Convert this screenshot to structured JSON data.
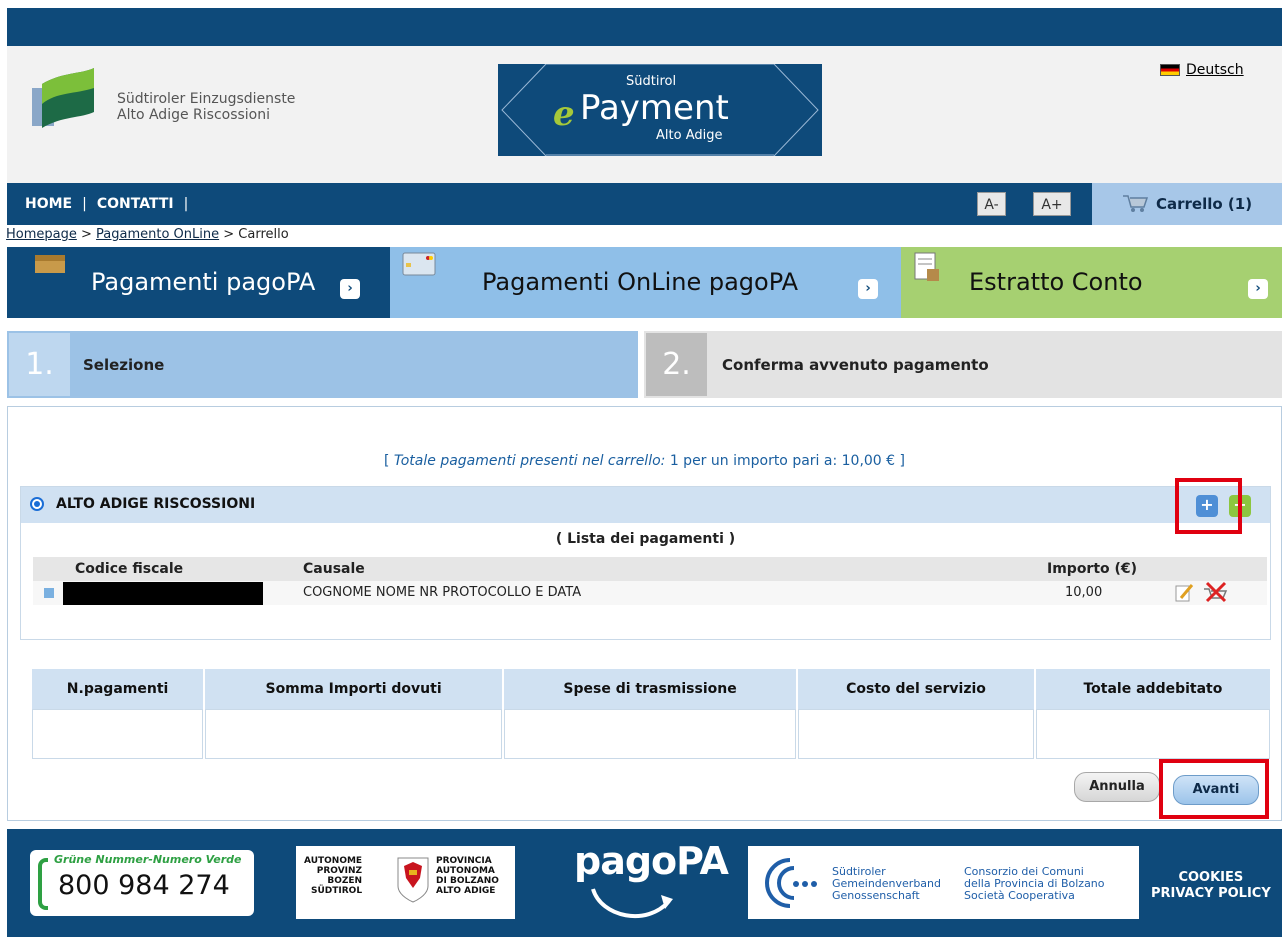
{
  "header": {
    "logo_line1": "Südtiroler Einzugsdienste",
    "logo_line2": "Alto Adige Riscossioni",
    "epayment_top": "Südtirol",
    "epayment_e": "e",
    "epayment_main": "Payment",
    "epayment_bottom": "Alto Adige",
    "language_link": "Deutsch"
  },
  "nav": {
    "home": "HOME",
    "sep1": "|",
    "contatti": "CONTATTI",
    "sep2": "|",
    "font_minus": "A-",
    "font_plus": "A+",
    "cart": "Carrello (1)"
  },
  "breadcrumb": {
    "homepage": "Homepage",
    "sep1": " > ",
    "pagamento": "Pagamento OnLine",
    "sep2": " > ",
    "current": "Carrello"
  },
  "tabs": [
    {
      "label": "Pagamenti pagoPA",
      "color": "#0e4a7a",
      "text_color": "#ffffff"
    },
    {
      "label": "Pagamenti OnLine pagoPA",
      "color": "#8fbfe8",
      "text_color": "#111111"
    },
    {
      "label": "Estratto Conto",
      "color": "#a6d071",
      "text_color": "#111111"
    }
  ],
  "steps": [
    {
      "num": "1.",
      "label": "Selezione",
      "color": "#9cc2e6"
    },
    {
      "num": "2.",
      "label": "Conferma avvenuto pagamento",
      "color": "#e3e3e3"
    }
  ],
  "cart_summary": {
    "prefix": "[ ",
    "italic": "Totale pagamenti presenti nel carrello:",
    "rest": " 1 per un importo pari a: 10,00 € ]"
  },
  "section": {
    "title": "ALTO ADIGE RISCOSSIONI",
    "add_blue": "+",
    "add_green": "+",
    "list_title": "( Lista dei pagamenti )",
    "columns": {
      "codice": "Codice fiscale",
      "causale": "Causale",
      "importo": "Importo (€)"
    },
    "rows": [
      {
        "causale": "COGNOME NOME NR PROTOCOLLO E DATA",
        "importo": "10,00"
      }
    ]
  },
  "totals": {
    "headers": [
      "N.pagamenti",
      "Somma Importi dovuti",
      "Spese di trasmissione",
      "Costo del servizio",
      "Totale addebitato"
    ]
  },
  "buttons": {
    "annulla": "Annulla",
    "avanti": "Avanti"
  },
  "footer": {
    "verde_head": "Grüne Nummer-Numero Verde",
    "verde_number": "800 984 274",
    "prov_left": [
      "AUTONOME",
      "PROVINZ",
      "BOZEN",
      "SÜDTIROL"
    ],
    "prov_right": [
      "PROVINCIA",
      "AUTONOMA",
      "DI BOLZANO",
      "ALTO ADIGE"
    ],
    "pagopa": "pagoPA",
    "gem_left": [
      "Südtiroler",
      "Gemeindenverband",
      "Genossenschaft"
    ],
    "gem_right": [
      "Consorzio dei Comuni",
      "della Provincia di Bolzano",
      "Società Cooperativa"
    ],
    "cookies": "COOKIES",
    "privacy": "PRIVACY POLICY"
  },
  "colors": {
    "brand_blue": "#0e4a7a",
    "highlight_red": "#e00010",
    "link_blue": "#1a5fa0"
  }
}
